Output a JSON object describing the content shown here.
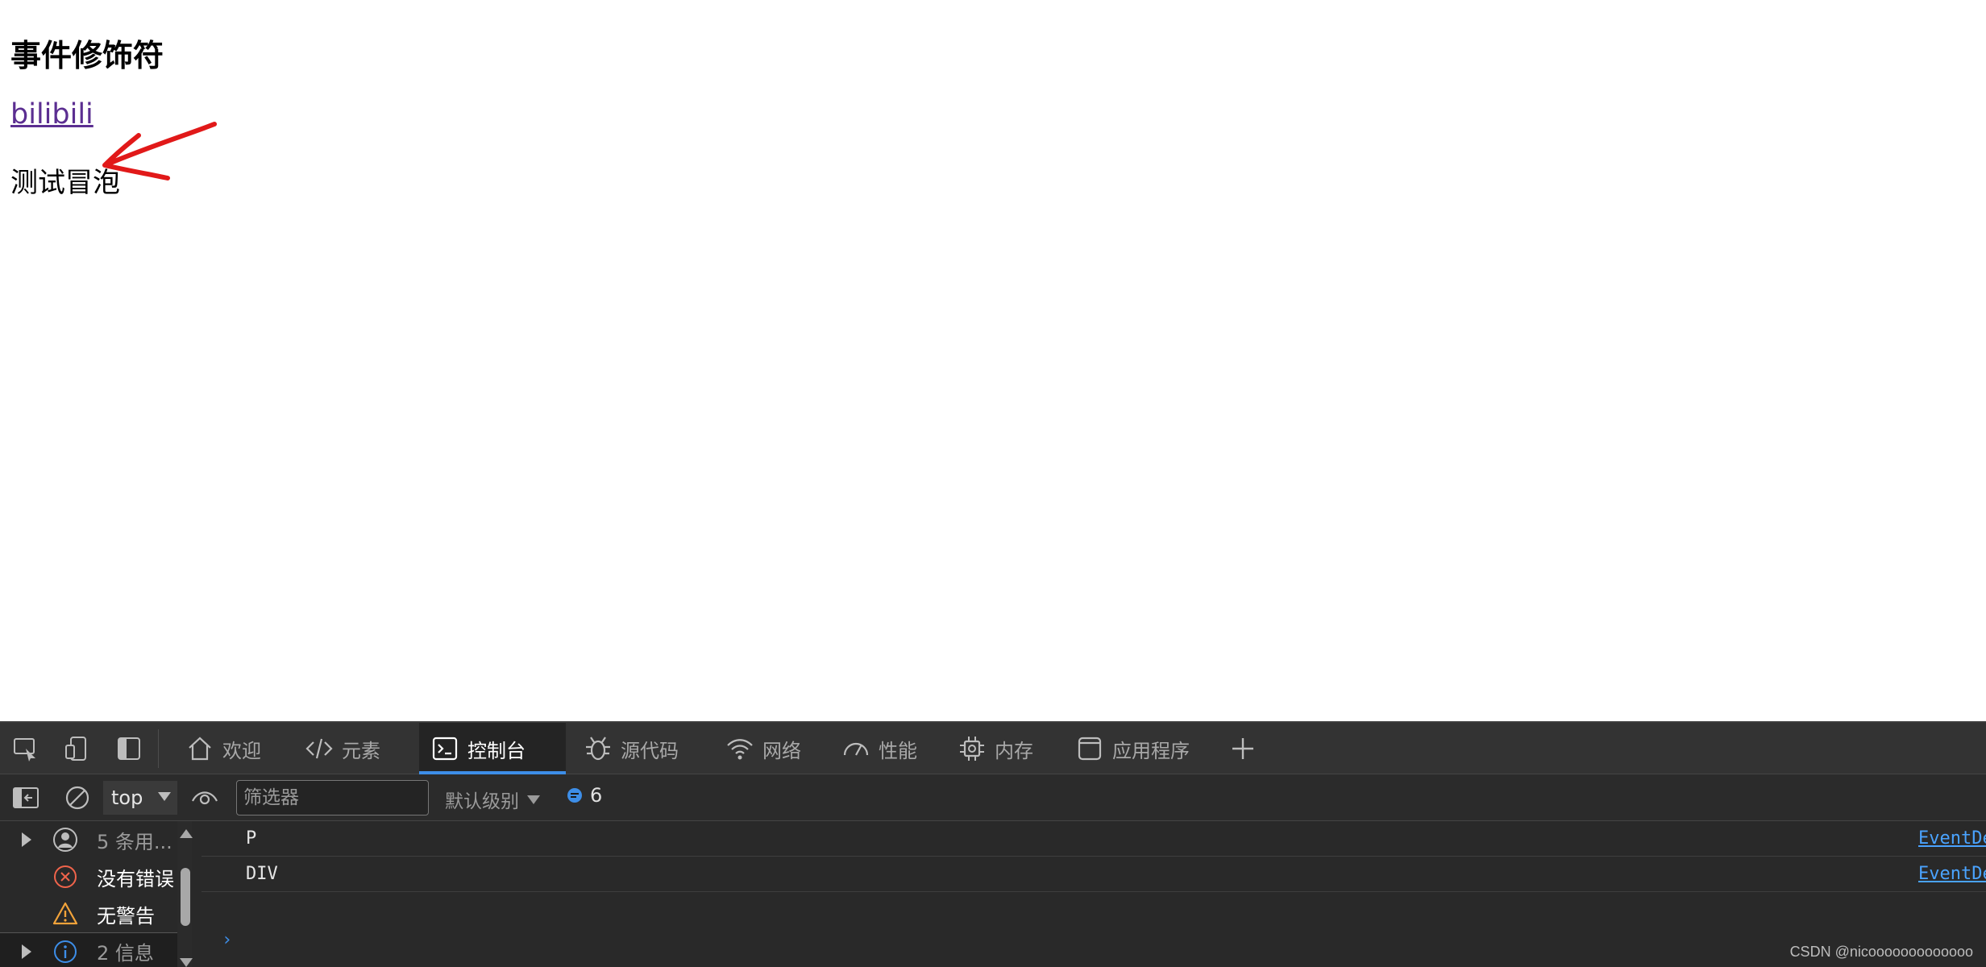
{
  "page": {
    "heading": "事件修饰符",
    "link_text": "bilibili",
    "paragraph": "测试冒泡"
  },
  "devtools": {
    "tabs": [
      {
        "label": "欢迎",
        "icon": "home-icon"
      },
      {
        "label": "元素",
        "icon": "code-icon"
      },
      {
        "label": "控制台",
        "icon": "console-icon",
        "active": true
      },
      {
        "label": "源代码",
        "icon": "bug-icon"
      },
      {
        "label": "网络",
        "icon": "wifi-icon"
      },
      {
        "label": "性能",
        "icon": "gauge-icon"
      },
      {
        "label": "内存",
        "icon": "chip-icon"
      },
      {
        "label": "应用程序",
        "icon": "window-icon"
      }
    ],
    "toolbar": {
      "context": "top",
      "filter_placeholder": "筛选器",
      "levels": "默认级别",
      "message_count": "6"
    },
    "sidebar": {
      "items": [
        {
          "label": "5 条用...",
          "icon": "user-icon"
        },
        {
          "label": "没有错误",
          "icon": "error-icon"
        },
        {
          "label": "无警告",
          "icon": "warning-icon"
        },
        {
          "label": "2 信息",
          "icon": "info-icon"
        }
      ]
    },
    "logs": [
      {
        "message": "P",
        "source": "EventDe"
      },
      {
        "message": "DIV",
        "source": "EventDe"
      }
    ],
    "prompt": "›"
  },
  "watermark": "CSDN @nicooooooooooooo",
  "colors": {
    "accent": "#3d8ee8",
    "annotation": "#e11919",
    "link": "#5b2e91"
  }
}
